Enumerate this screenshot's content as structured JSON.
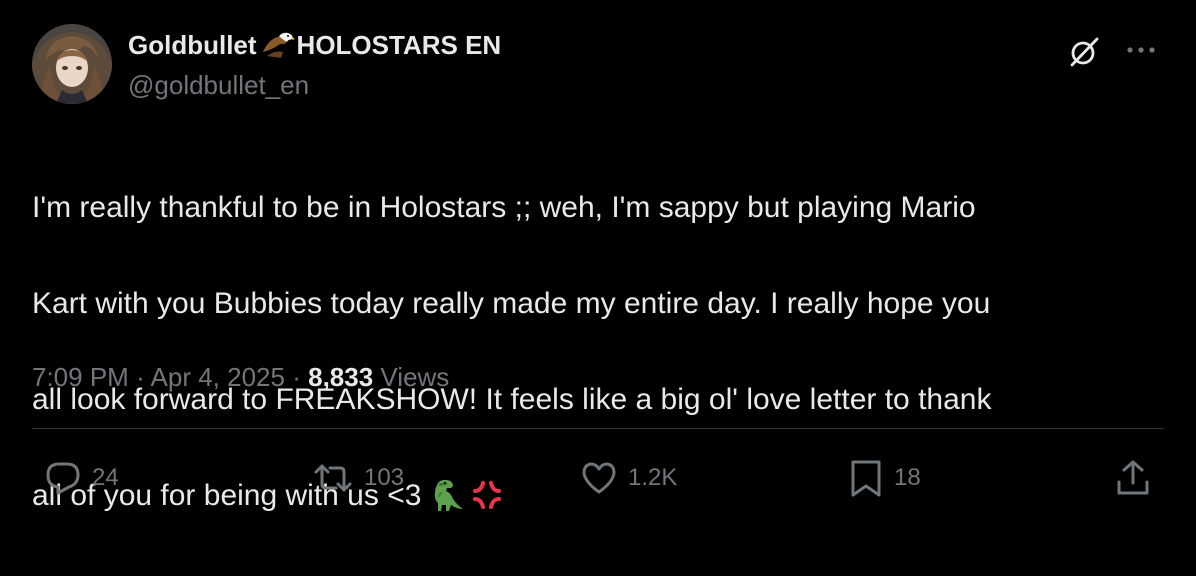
{
  "author": {
    "display_name": "Goldbullet",
    "affiliation": "HOLOSTARS EN",
    "handle": "@goldbullet_en",
    "badge_icon": "eagle-icon"
  },
  "header_actions": {
    "grok_icon": "grok-icon",
    "more_icon": "more-icon"
  },
  "tweet": {
    "text_lines": [
      "I'm really thankful to be in Holostars ;; weh, I'm sappy but playing Mario",
      "Kart with you Bubbies today really made my entire day. I really hope you",
      "all look forward to FREAKSHOW! It feels like a big ol' love letter to thank",
      "all of you for being with us <3"
    ],
    "emojis": [
      "t-rex-emoji",
      "anger-symbol-emoji"
    ]
  },
  "meta": {
    "time": "7:09 PM",
    "separator": "·",
    "date": "Apr 4, 2025",
    "views_count": "8,833",
    "views_label": "Views"
  },
  "actions": {
    "reply_count": "24",
    "retweet_count": "103",
    "like_count": "1.2K",
    "bookmark_count": "18"
  },
  "colors": {
    "background": "#000000",
    "text_primary": "#e7e9ea",
    "text_secondary": "#71767b",
    "divider": "#2f3336"
  }
}
